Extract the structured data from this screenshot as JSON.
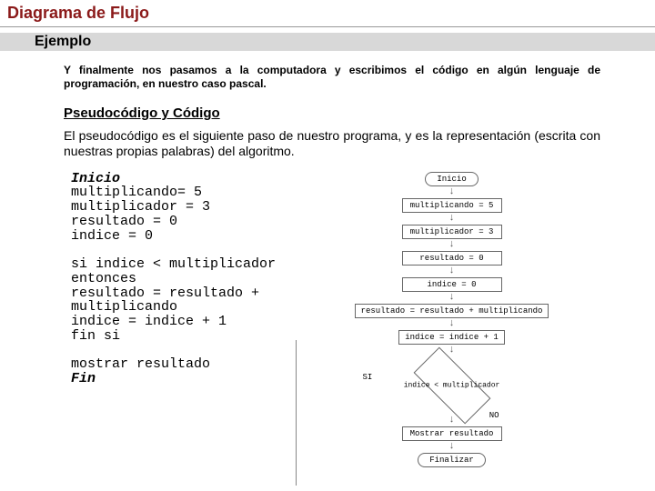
{
  "page_title": "Diagrama de Flujo",
  "example_label": "Ejemplo",
  "intro": "Y finalmente nos pasamos a la computadora y escribimos el código en algún lenguaje de programación, en nuestro caso pascal.",
  "subheading": "Pseudocódigo y Código",
  "desc": "El pseudocódigo es el siguiente paso de nuestro programa, y es la representación (escrita con nuestras propias palabras) del algoritmo.",
  "pseudocode": {
    "kw_start": "Inicio",
    "l1": "multiplicando= 5",
    "l2": "multiplicador = 3",
    "l3": "resultado = 0",
    "l4": "indice = 0",
    "l5": "si indice < multiplicador",
    "l6": "entonces",
    "l7": "resultado = resultado +",
    "l8": "multiplicando",
    "l9": "indice = indice + 1",
    "l10": "fin si",
    "l11": "mostrar resultado",
    "kw_end": "Fin"
  },
  "flowchart": {
    "start": "Inicio",
    "n1": "multiplicando = 5",
    "n2": "multiplicador = 3",
    "n3": "resultado = 0",
    "n4": "indice = 0",
    "n5": "resultado = resultado + multiplicando",
    "n6": "indice = indice + 1",
    "decision": "indice < multiplicador",
    "yes": "SI",
    "no": "NO",
    "out": "Mostrar resultado",
    "end": "Finalizar"
  }
}
